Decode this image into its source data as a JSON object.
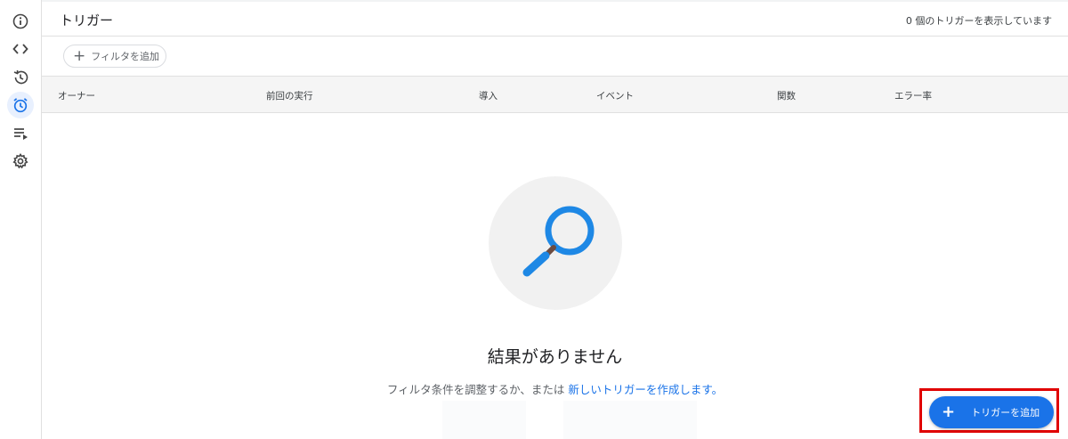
{
  "sidebar": {
    "items": [
      {
        "icon": "info-icon",
        "active": false
      },
      {
        "icon": "code-icon",
        "active": false
      },
      {
        "icon": "history-icon",
        "active": false
      },
      {
        "icon": "alarm-clock-icon",
        "active": true
      },
      {
        "icon": "playlist-icon",
        "active": false
      },
      {
        "icon": "gear-icon",
        "active": false
      }
    ]
  },
  "header": {
    "title": "トリガー",
    "count_text": "0 個のトリガーを表示しています"
  },
  "filter": {
    "add_label": "フィルタを追加"
  },
  "table": {
    "columns": [
      "オーナー",
      "前回の実行",
      "導入",
      "イベント",
      "関数",
      "エラー率"
    ]
  },
  "empty_state": {
    "icon": "search-icon",
    "title": "結果がありません",
    "subtitle_prefix": "フィルタ条件を調整するか、または ",
    "subtitle_link": "新しいトリガーを作成します。"
  },
  "fab": {
    "label": "トリガーを追加"
  },
  "colors": {
    "accent": "#1a73e8",
    "highlight": "#e00000",
    "search_icon": "#1e88e5"
  }
}
